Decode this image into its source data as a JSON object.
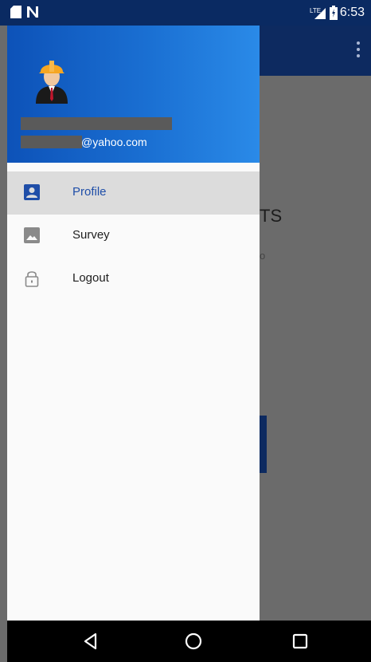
{
  "status_bar": {
    "time": "6:53",
    "icons": [
      "sd-card-icon",
      "n-notification-icon",
      "lte-signal-icon",
      "battery-charging-icon"
    ]
  },
  "drawer": {
    "header": {
      "avatar": "engineer-avatar",
      "name_redacted": true,
      "email_suffix": "@yahoo.com"
    },
    "menu": [
      {
        "label": "Profile",
        "icon": "account-box-icon",
        "active": true
      },
      {
        "label": "Survey",
        "icon": "image-icon",
        "active": false
      },
      {
        "label": "Logout",
        "icon": "lock-icon",
        "active": false
      }
    ]
  },
  "background": {
    "visible_text_1": "TS",
    "visible_text_2": "o"
  },
  "nav_bar": {
    "buttons": [
      "back-icon",
      "home-icon",
      "recents-icon"
    ]
  },
  "colors": {
    "drawer_header_start": "#0d52b8",
    "drawer_header_end": "#2a8ae8",
    "active_item_bg": "#dcdcdc",
    "active_label": "#1f4ea8",
    "app_bar": "#0d2a60",
    "scrim": "#6b6b6b"
  }
}
